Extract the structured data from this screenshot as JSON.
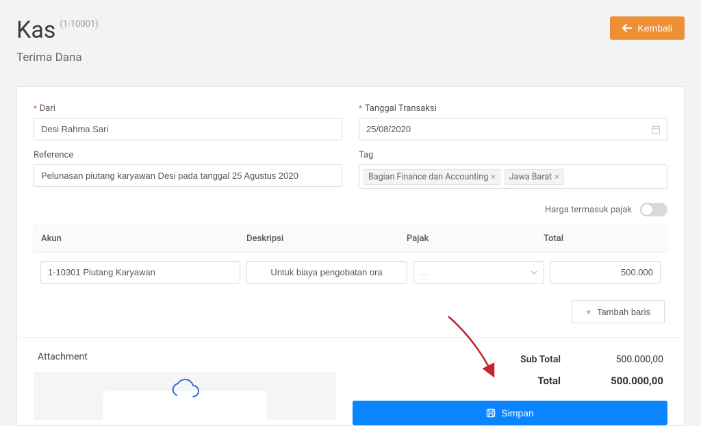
{
  "header": {
    "title": "Kas",
    "code": "(1-10001)",
    "subtitle": "Terima Dana",
    "back_label": "Kembali"
  },
  "form": {
    "from_label": "Dari",
    "from_value": "Desi Rahma Sari",
    "date_label": "Tanggal Transaksi",
    "date_value": "25/08/2020",
    "ref_label": "Reference",
    "ref_value": "Pelunasan piutang karyawan Desi pada tanggal 25 Agustus 2020",
    "tag_label": "Tag",
    "tags": [
      "Bagian Finance dan Accounting",
      "Jawa Barat"
    ],
    "tax_incl_label": "Harga termasuk pajak"
  },
  "table": {
    "head": {
      "akun": "Akun",
      "deskripsi": "Deskripsi",
      "pajak": "Pajak",
      "total": "Total"
    },
    "row": {
      "akun": "1-10301 Piutang Karyawan",
      "deskripsi": "Untuk biaya pengobatan ora",
      "pajak": "...",
      "total": "500.000"
    },
    "add_label": "Tambah baris"
  },
  "totals": {
    "subtotal_label": "Sub Total",
    "subtotal_value": "500.000,00",
    "total_label": "Total",
    "total_value": "500.000,00"
  },
  "attachment": {
    "title": "Attachment"
  },
  "actions": {
    "save_label": "Simpan"
  }
}
